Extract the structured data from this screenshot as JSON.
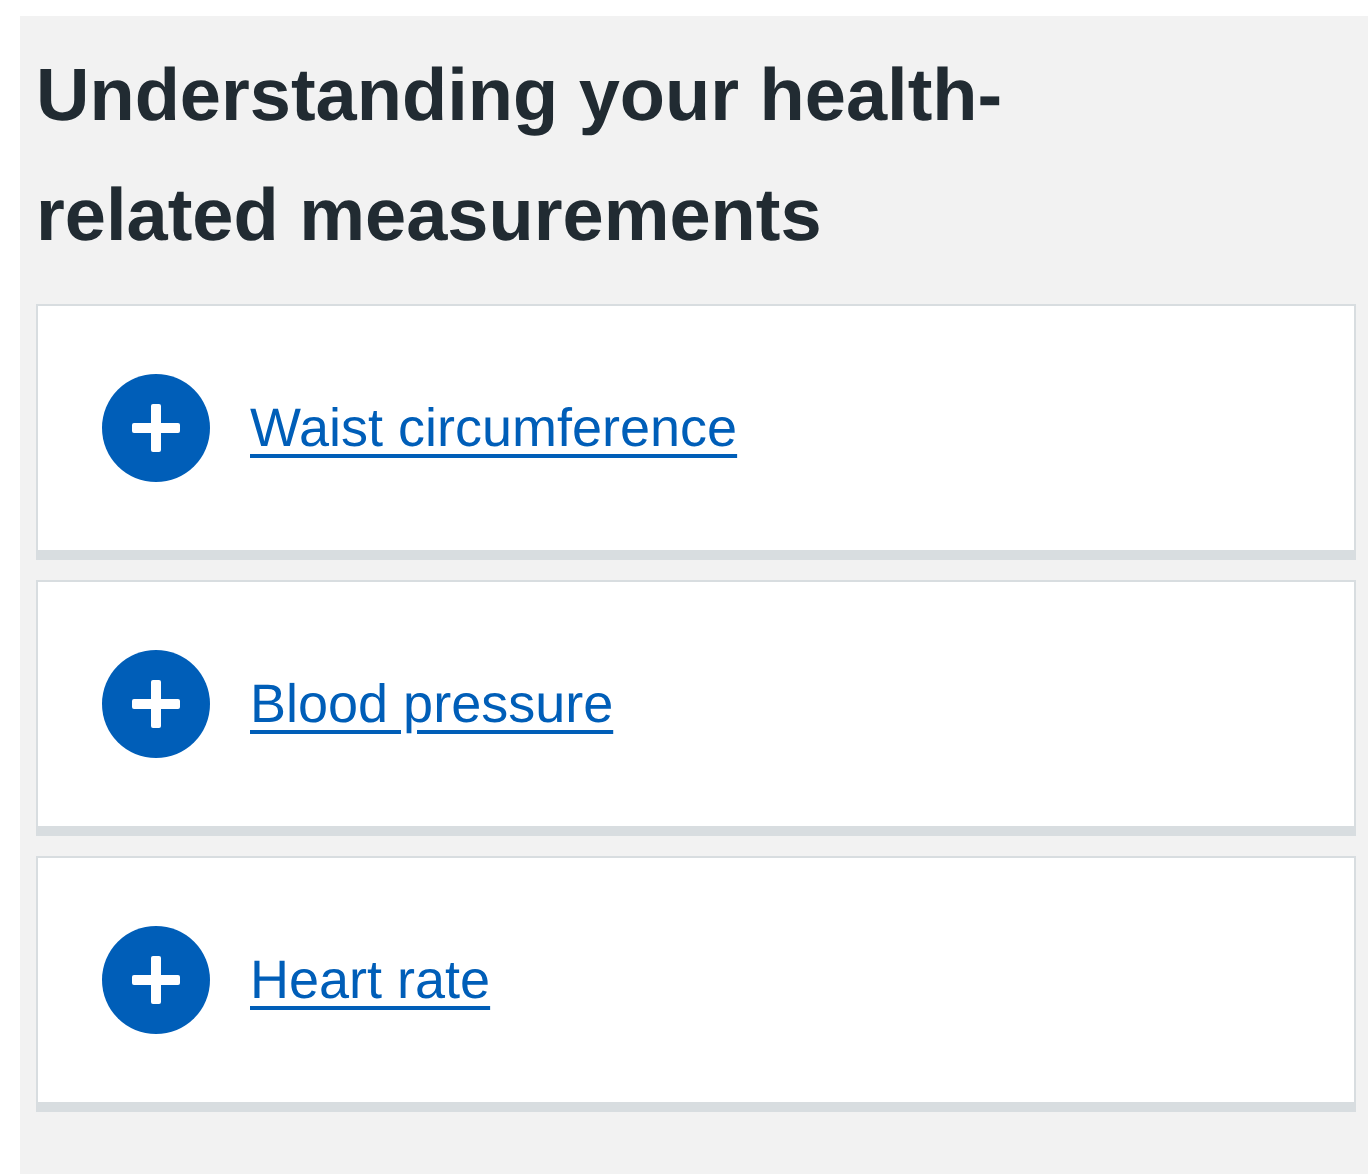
{
  "heading": "Understanding your health-related measurements",
  "sections": [
    {
      "label": "Waist circumference",
      "expanded": false
    },
    {
      "label": "Blood pressure",
      "expanded": false
    },
    {
      "label": "Heart rate",
      "expanded": false
    }
  ]
}
